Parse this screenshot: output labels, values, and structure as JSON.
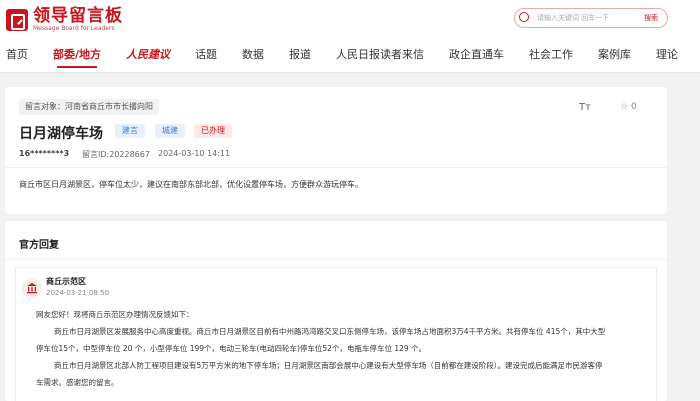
{
  "header": {
    "logo": {
      "title": "领导留言板",
      "subtitle": "Message Board for Leaders"
    },
    "search": {
      "placeholder": "请输入关键词 回车一下",
      "button_label": "搜索"
    }
  },
  "nav": {
    "items": [
      {
        "label": "首页"
      },
      {
        "label": "部委/地方"
      },
      {
        "label": "人民建议"
      },
      {
        "label": "话题"
      },
      {
        "label": "数据"
      },
      {
        "label": "报道"
      },
      {
        "label": "人民日报读者来信"
      },
      {
        "label": "政企直通车"
      },
      {
        "label": "社会工作"
      },
      {
        "label": "案例库"
      },
      {
        "label": "理论"
      }
    ],
    "active_index": 1
  },
  "message": {
    "target": "留言对象：河南省商丘市市长撂向阳",
    "font_icon": "Tт",
    "favorite_count": "0",
    "title": "日月湖停车场",
    "tags": [
      "建言",
      "城建",
      "已办理"
    ],
    "user": "16********3",
    "message_id": "留言ID:20228667",
    "date": "2024-03-10 14:11",
    "body": "商丘市区日月湖景区，停车位太少，建议在南部东部北部，优化设置停车场，方便群众游玩停车。"
  },
  "reply": {
    "heading": "官方回复",
    "org_name": "商丘示范区",
    "org_date": "2024-03-21 08:50",
    "paragraphs": [
      "网友您好！现将商丘示范区办理情况反馈如下：",
      "商丘市日月湖景区发展服务中心高度重视。商丘市日月湖景区目前有中州路鸿湾路交叉口东侧停车场，该停车场占地面积3万4千平方米。共有停车位 415个，其中大型",
      "停车位15个，中型停车位 20 个，小型停车位 199个，电动三轮车(电动四轮车)停车位52个，电瓶车停车位 129 个。",
      "商丘市日月湖景区北部人防工程项目建设有5万平方米的地下停车场；日月湖景区南部会展中心建设有大型停车场（目前都在建设阶段）。建设完成后能满足市民游客停",
      "车需求。感谢您的留言。"
    ]
  },
  "colors": {
    "brand": "#c8161d",
    "tag_blue": "#3a7bd5"
  }
}
